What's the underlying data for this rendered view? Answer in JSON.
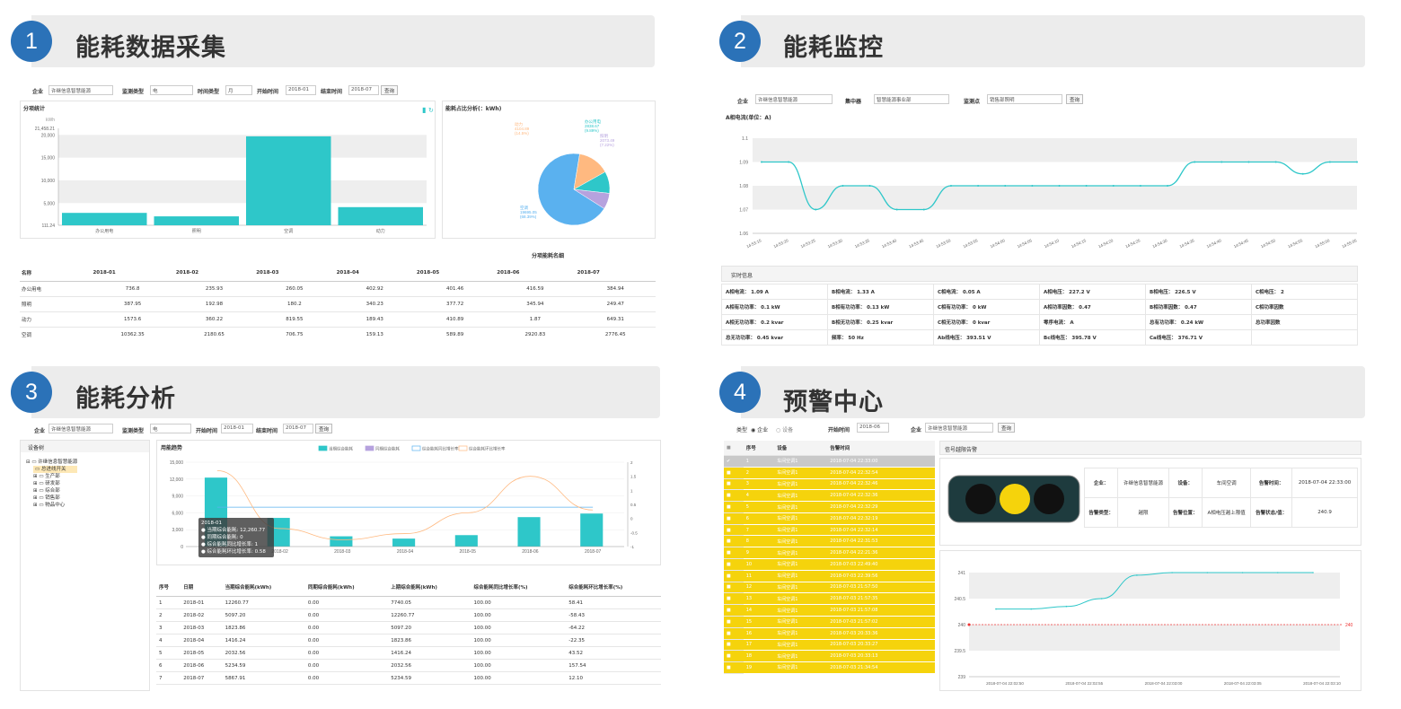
{
  "sections": [
    {
      "num": "1",
      "title": "能耗数据采集"
    },
    {
      "num": "2",
      "title": "能耗监控"
    },
    {
      "num": "3",
      "title": "能耗分析"
    },
    {
      "num": "4",
      "title": "预警中心"
    }
  ],
  "colors": {
    "accent": "#2b72b8",
    "teal": "#2ec7c9",
    "purple": "#b6a2de",
    "blue": "#5ab1ef",
    "orange": "#ffb980",
    "yellow": "#f5d30c"
  },
  "s1": {
    "filters": {
      "company_label": "企业",
      "company_value": "许继信息智慧能源",
      "type_label": "监测类型",
      "type_value": "电",
      "time_label": "时间类型",
      "time_value": "月",
      "start_label": "开始时间",
      "start_value": "2018-01",
      "end_label": "结束时间",
      "end_value": "2018-07",
      "query": "查询"
    },
    "bar_panel_title": "分项统计",
    "pie_panel_title": "能耗占比分析(：kWh)",
    "table_title": "分项能耗名细",
    "table": {
      "headers": [
        "名称",
        "2018-01",
        "2018-02",
        "2018-03",
        "2018-04",
        "2018-05",
        "2018-06",
        "2018-07"
      ],
      "rows": [
        [
          "办公用电",
          "736.8",
          "235.93",
          "260.05",
          "402.92",
          "401.46",
          "416.59",
          "384.94"
        ],
        [
          "照明",
          "387.95",
          "192.98",
          "180.2",
          "340.23",
          "377.72",
          "345.94",
          "249.47"
        ],
        [
          "动力",
          "1573.6",
          "360.22",
          "819.55",
          "189.43",
          "410.89",
          "1.87",
          "649.31"
        ],
        [
          "空调",
          "10362.35",
          "2180.65",
          "706.75",
          "159.13",
          "589.89",
          "2920.83",
          "2776.45"
        ]
      ]
    },
    "pie_labels": [
      {
        "t": "动力",
        "v": "4104.89",
        "p": "(14.5%)"
      },
      {
        "t": "办公用电",
        "v": "2838.67",
        "p": "(9.89%)"
      },
      {
        "t": "照明",
        "v": "2073.49",
        "p": "(7.22%)"
      },
      {
        "t": "空调",
        "v": "19695.05",
        "p": "(68.39%)"
      }
    ]
  },
  "chart_data": [
    {
      "type": "bar",
      "title": "分项统计",
      "ylabel": "kWh",
      "categories": [
        "办公用电",
        "照明",
        "空调",
        "动力"
      ],
      "values": [
        2838.67,
        2073.49,
        19695.05,
        4104.89
      ],
      "ylim": [
        111.24,
        21458.21
      ],
      "yticks": [
        "21,458.21",
        "20,000",
        "15,000",
        "10,000",
        "5,000",
        "111.24"
      ]
    },
    {
      "type": "pie",
      "title": "能耗占比分析(：kWh)",
      "categories": [
        "空调",
        "动力",
        "办公用电",
        "照明"
      ],
      "values": [
        19695.05,
        4104.89,
        2838.67,
        2073.49
      ]
    },
    {
      "type": "line",
      "title": "A相电流(单位：A)",
      "x": [
        "14:53:15",
        "14:53:20",
        "14:53:25",
        "14:53:30",
        "14:53:35",
        "14:53:40",
        "14:53:45",
        "14:53:50",
        "14:53:55",
        "14:54:00",
        "14:54:05",
        "14:54:10",
        "14:54:15",
        "14:54:20",
        "14:54:25",
        "14:54:30",
        "14:54:35",
        "14:54:40",
        "14:54:45",
        "14:54:50",
        "14:54:55",
        "14:55:00",
        "14:55:05"
      ],
      "values": [
        1.09,
        1.09,
        1.07,
        1.08,
        1.08,
        1.07,
        1.07,
        1.08,
        1.08,
        1.08,
        1.08,
        1.08,
        1.08,
        1.08,
        1.08,
        1.08,
        1.09,
        1.09,
        1.09,
        1.09,
        1.085,
        1.09,
        1.09
      ],
      "ylim": [
        1.06,
        1.1
      ],
      "yticks": [
        "1.1",
        "1.09",
        "1.08",
        "1.07",
        "1.06"
      ]
    },
    {
      "type": "bar",
      "title": "用能趋势",
      "categories": [
        "2018-01",
        "2018-02",
        "2018-03",
        "2018-04",
        "2018-05",
        "2018-06",
        "2018-07"
      ],
      "series": [
        {
          "name": "当期综合能耗",
          "values": [
            12260.77,
            5097.2,
            1823.86,
            1416.24,
            2032.56,
            5234.59,
            5867.91
          ]
        }
      ],
      "ylim": [
        0,
        15000
      ],
      "yticks": [
        "15,000",
        "12,000",
        "9,000",
        "6,000",
        "3,000",
        "0"
      ],
      "legend": [
        "当期综合能耗",
        "同期综合能耗",
        "综合能耗同比增长率",
        "综合能耗环比增长率"
      ]
    },
    {
      "type": "line",
      "title": "告警曲线",
      "x": [
        "2018-07-04 22:02:50",
        "2018-07-04 22:02:55",
        "2018-07-04 22:03:00",
        "2018-07-04 22:03:05",
        "2018-07-04 22:03:10"
      ],
      "values": [
        240.3,
        240.3,
        240.35,
        240.5,
        240.95,
        241,
        241,
        241,
        241,
        241
      ],
      "threshold": 240,
      "ylim": [
        239,
        241
      ],
      "yticks": [
        "241",
        "240.5",
        "240",
        "239.5",
        "239"
      ]
    }
  ],
  "s2": {
    "filters": {
      "company_label": "企业",
      "company_value": "许继信息智慧能源",
      "center_label": "集中器",
      "center_value": "智慧能源事业部",
      "point_label": "监测点",
      "point_value": "销售部照明",
      "query": "查询"
    },
    "chart_title": "A相电流(单位：A)",
    "rt_title": "实时信息",
    "rt_rows": [
      [
        "A相电流： 1.09 A",
        "B相电流： 1.33 A",
        "C相电流： 0.05 A",
        "A相电压： 227.2 V",
        "B相电压： 226.5 V",
        "C相电压： 2"
      ],
      [
        "A相有功功率： 0.1 kW",
        "B相有功功率： 0.13 kW",
        "C相有功功率： 0 kW",
        "A相功率因数： 0.47",
        "B相功率因数： 0.47",
        "C相功率因数"
      ],
      [
        "A相无功功率： 0.2 kvar",
        "B相无功功率： 0.25 kvar",
        "C相无功功率： 0 kvar",
        "零序电流： A",
        "总有功功率： 0.24 kW",
        "总功率因数"
      ],
      [
        "总无功功率： 0.45 kvar",
        "频率： 50 Hz",
        "Ab线电压： 393.51 V",
        "Bc线电压： 395.78 V",
        "Ca线电压： 376.71 V",
        ""
      ]
    ]
  },
  "s3": {
    "filters": {
      "company_label": "企业",
      "company_value": "许继信息智慧能源",
      "type_label": "监测类型",
      "type_value": "电",
      "start_label": "开始时间",
      "start_value": "2018-01",
      "end_label": "结束时间",
      "end_value": "2018-07",
      "query": "查询"
    },
    "tree_title": "设备树",
    "tree": [
      "许继信息智慧能源",
      "总进线开关",
      "生产部",
      "研发部",
      "综合部",
      "销售部",
      "物品中心"
    ],
    "chart_title": "用能趋势",
    "tooltip": [
      "2018-01",
      "当期综合能耗: 12,260.77",
      "同期综合能耗: 0",
      "综合能耗同比增长率: 1",
      "综合能耗环比增长率: 0.58"
    ],
    "table": {
      "headers": [
        "序号",
        "日期",
        "当期综合能耗(kWh)",
        "同期综合能耗(kWh)",
        "上期综合能耗(kWh)",
        "综合能耗同比增长率(%)",
        "综合能耗环比增长率(%)"
      ],
      "rows": [
        [
          "1",
          "2018-01",
          "12260.77",
          "0.00",
          "7740.05",
          "100.00",
          "58.41"
        ],
        [
          "2",
          "2018-02",
          "5097.20",
          "0.00",
          "12260.77",
          "100.00",
          "-58.43"
        ],
        [
          "3",
          "2018-03",
          "1823.86",
          "0.00",
          "5097.20",
          "100.00",
          "-64.22"
        ],
        [
          "4",
          "2018-04",
          "1416.24",
          "0.00",
          "1823.86",
          "100.00",
          "-22.35"
        ],
        [
          "5",
          "2018-05",
          "2032.56",
          "0.00",
          "1416.24",
          "100.00",
          "43.52"
        ],
        [
          "6",
          "2018-06",
          "5234.59",
          "0.00",
          "2032.56",
          "100.00",
          "157.54"
        ],
        [
          "7",
          "2018-07",
          "5867.91",
          "0.00",
          "5234.59",
          "100.00",
          "12.10"
        ]
      ]
    }
  },
  "s4": {
    "filters": {
      "type_label": "类型",
      "opt1": "企业",
      "opt2": "设备",
      "start_label": "开始时间",
      "start_value": "2018-06",
      "company_label": "企业",
      "company_value": "许继信息智慧能源",
      "query": "查询"
    },
    "list_headers": [
      "序号",
      "设备",
      "告警时间"
    ],
    "list": [
      [
        "1",
        "车间空调1",
        "2018-07-04 22:33:00"
      ],
      [
        "2",
        "车间空调1",
        "2018-07-04 22:32:54"
      ],
      [
        "3",
        "车间空调1",
        "2018-07-04 22:32:46"
      ],
      [
        "4",
        "车间空调1",
        "2018-07-04 22:32:36"
      ],
      [
        "5",
        "车间空调1",
        "2018-07-04 22:32:29"
      ],
      [
        "6",
        "车间空调1",
        "2018-07-04 22:32:19"
      ],
      [
        "7",
        "车间空调1",
        "2018-07-04 22:32:14"
      ],
      [
        "8",
        "车间空调1",
        "2018-07-04 22:31:53"
      ],
      [
        "9",
        "车间空调1",
        "2018-07-04 22:21:36"
      ],
      [
        "10",
        "车间空调1",
        "2018-07-03 22:49:40"
      ],
      [
        "11",
        "车间空调1",
        "2018-07-03 22:39:56"
      ],
      [
        "12",
        "车间空调1",
        "2018-07-03 21:57:50"
      ],
      [
        "13",
        "车间空调1",
        "2018-07-03 21:57:35"
      ],
      [
        "14",
        "车间空调1",
        "2018-07-03 21:57:08"
      ],
      [
        "15",
        "车间空调1",
        "2018-07-03 21:57:02"
      ],
      [
        "16",
        "车间空调1",
        "2018-07-03 20:33:36"
      ],
      [
        "17",
        "车间空调1",
        "2018-07-03 20:33:27"
      ],
      [
        "18",
        "车间空调1",
        "2018-07-03 20:33:13"
      ],
      [
        "19",
        "车间空调1",
        "2018-07-03 21:34:54"
      ]
    ],
    "detail_title": "信号越限告警",
    "info": {
      "company_l": "企业：",
      "company_v": "许继信息智慧能源",
      "device_l": "设备：",
      "device_v": "车间空调",
      "time_l": "告警时间：",
      "time_v": "2018-07-04 22:33:00",
      "type_l": "告警类型：",
      "type_v": "越限",
      "pos_l": "告警位置：",
      "pos_v": "A相电压越上限值",
      "state_l": "告警状态/值：",
      "state_v": "240.9"
    },
    "threshold_label": "240"
  }
}
